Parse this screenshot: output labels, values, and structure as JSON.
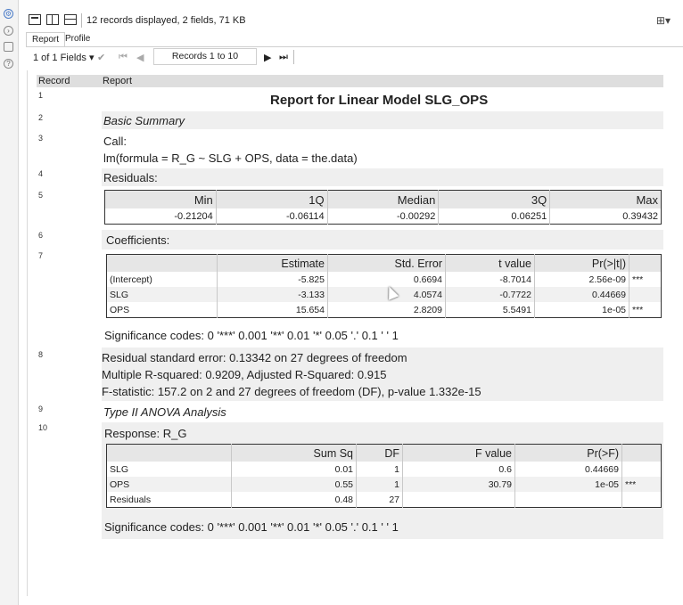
{
  "toolbar": {
    "records_info": "12 records displayed, 2 fields, 71 KB"
  },
  "tabs": [
    "Report",
    "Profile"
  ],
  "nav": {
    "fields_select": "1 of 1 Fields",
    "records_range": "Records 1 to 10"
  },
  "grid": {
    "headers": {
      "record": "Record",
      "report": "Report"
    },
    "records": [
      {
        "num": "1",
        "text": "Report for Linear Model SLG_OPS"
      },
      {
        "num": "2",
        "text": "Basic Summary"
      },
      {
        "num": "3",
        "line1": "Call:",
        "line2": "lm(formula = R_G ~ SLG + OPS, data = the.data)"
      },
      {
        "num": "4",
        "text": "Residuals:"
      },
      {
        "num": "5"
      },
      {
        "num": "6",
        "text": "Coefficients:"
      },
      {
        "num": "7",
        "signif": "Significance codes: 0 '***' 0.001 '**' 0.01 '*' 0.05 '.' 0.1 ' ' 1"
      },
      {
        "num": "8",
        "line1": "Residual standard error: 0.13342 on 27 degrees of freedom",
        "line2": "Multiple R-squared: 0.9209, Adjusted R-Squared: 0.915",
        "line3": "F-statistic: 157.2 on 2 and 27 degrees of freedom (DF), p-value 1.332e-15"
      },
      {
        "num": "9",
        "text": "Type II ANOVA Analysis"
      },
      {
        "num": "10",
        "response": "Response: R_G",
        "signif": "Significance codes: 0 '***' 0.001 '**' 0.01 '*' 0.05 '.' 0.1 ' ' 1"
      }
    ]
  },
  "residuals": {
    "headers": [
      "Min",
      "1Q",
      "Median",
      "3Q",
      "Max"
    ],
    "values": [
      "-0.21204",
      "-0.06114",
      "-0.00292",
      "0.06251",
      "0.39432"
    ]
  },
  "coefficients": {
    "headers": [
      "",
      "Estimate",
      "Std. Error",
      "t value",
      "Pr(>|t|)",
      ""
    ],
    "rows": [
      [
        "(Intercept)",
        "-5.825",
        "0.6694",
        "-8.7014",
        "2.56e-09",
        "***"
      ],
      [
        "SLG",
        "-3.133",
        "4.0574",
        "-0.7722",
        "0.44669",
        ""
      ],
      [
        "OPS",
        "15.654",
        "2.8209",
        "5.5491",
        "1e-05",
        "***"
      ]
    ]
  },
  "anova": {
    "headers": [
      "",
      "Sum Sq",
      "DF",
      "F value",
      "Pr(>F)",
      ""
    ],
    "rows": [
      [
        "SLG",
        "0.01",
        "1",
        "0.6",
        "0.44669",
        ""
      ],
      [
        "OPS",
        "0.55",
        "1",
        "30.79",
        "1e-05",
        "***"
      ],
      [
        "Residuals",
        "0.48",
        "27",
        "",
        "",
        ""
      ]
    ]
  }
}
